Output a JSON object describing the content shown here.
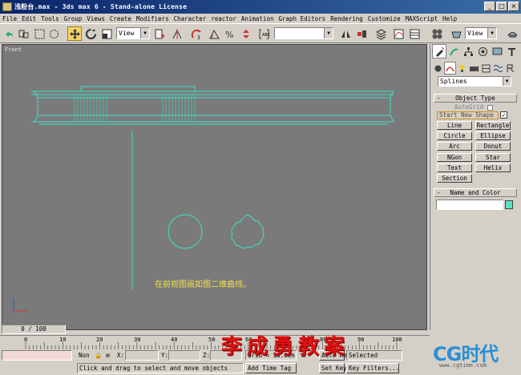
{
  "window": {
    "title": "浅粉台.max - 3ds max 6 - Stand-alone License"
  },
  "menu": [
    "File",
    "Edit",
    "Tools",
    "Group",
    "Views",
    "Create",
    "Modifiers",
    "Character",
    "reactor",
    "Animation",
    "Graph Editors",
    "Rendering",
    "Customize",
    "MAXScript",
    "Help"
  ],
  "toolbar": {
    "ref_coord": "View",
    "selection_set": "",
    "view_right": "View"
  },
  "viewport": {
    "label": "Front",
    "annotation": "在前视图画如图二维曲线。"
  },
  "command_panel": {
    "category": "Splines",
    "object_type_title": "Object Type",
    "autogrid": "AutoGrid",
    "start_new_shape": "Start New Shape",
    "start_new_shape_check": "✓",
    "buttons": [
      "Line",
      "Rectangle",
      "Circle",
      "Ellipse",
      "Arc",
      "Donut",
      "NGon",
      "Star",
      "Text",
      "Helix",
      "Section"
    ],
    "name_color_title": "Name and Color",
    "collapse": "-"
  },
  "timeline": {
    "slider": "0 / 100",
    "ticks": [
      "0",
      "10",
      "20",
      "30",
      "40",
      "50",
      "60",
      "70",
      "80",
      "90",
      "100"
    ]
  },
  "status": {
    "none": "Non",
    "x_label": "X:",
    "y_label": "Y:",
    "z_label": "Z:",
    "grid": "Grid = 10.0cm",
    "auto_key": "Auto Key",
    "selected": "Selected",
    "set_key": "Set Key",
    "key_filters": "Key Filters...",
    "prompt": "Click and drag to select and move objects",
    "add_time_tag": "Add Time Tag"
  },
  "watermark": "李成勇教案",
  "logo": {
    "brand": "CG时代",
    "url": "www.cgtime.com"
  }
}
